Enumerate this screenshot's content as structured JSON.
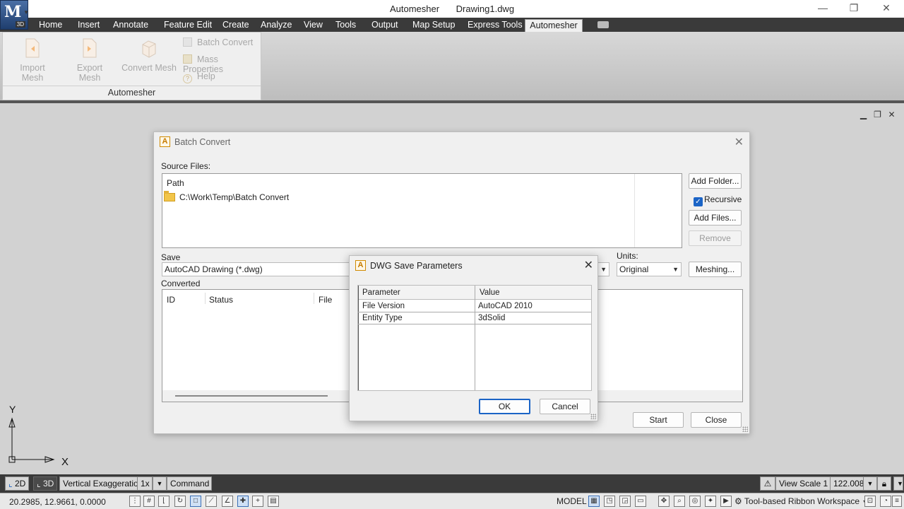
{
  "app": {
    "title": "Automesher",
    "document": "Drawing1.dwg",
    "badge": "3D"
  },
  "menu": {
    "tabs": [
      "Home",
      "Insert",
      "Annotate",
      "Feature Edit",
      "Create",
      "Analyze",
      "View",
      "Tools",
      "Output",
      "Map Setup",
      "Express Tools",
      "Automesher"
    ],
    "active": "Automesher"
  },
  "ribbon": {
    "panel_title": "Automesher",
    "import_mesh": "Import Mesh",
    "export_mesh": "Export Mesh",
    "convert_mesh": "Convert Mesh",
    "batch_convert": "Batch Convert",
    "mass_properties": "Mass Properties",
    "help": "Help"
  },
  "batch_dialog": {
    "title": "Batch Convert",
    "source_files_label": "Source Files:",
    "path_header": "Path",
    "source_path": "C:\\Work\\Temp\\Batch Convert",
    "add_folder": "Add Folder...",
    "recursive": "Recursive",
    "add_files": "Add Files...",
    "remove": "Remove",
    "save_label": "Save",
    "save_format": "AutoCAD Drawing (*.dwg)",
    "units_label": "Units:",
    "units_value": "Original",
    "meshing": "Meshing...",
    "converted_label": "Converted",
    "columns": [
      "ID",
      "Status",
      "File"
    ],
    "start": "Start",
    "close": "Close"
  },
  "dwg_dialog": {
    "title": "DWG Save Parameters",
    "headers": [
      "Parameter",
      "Value"
    ],
    "rows": [
      {
        "param": "File Version",
        "value": "AutoCAD 2010"
      },
      {
        "param": "Entity Type",
        "value": "3dSolid"
      }
    ],
    "ok": "OK",
    "cancel": "Cancel"
  },
  "ucs": {
    "x": "X",
    "y": "Y"
  },
  "layout_bar": {
    "btn_2d": "2D",
    "btn_3d": "3D",
    "vertical_exaggeration": "Vertical Exaggeration:",
    "ve_value": "1x",
    "command": "Command",
    "view_scale": "View Scale",
    "view_scale_ratio": "1 :",
    "view_scale_value": "122.008"
  },
  "status_bar": {
    "coords": "20.2985, 12.9661, 0.0000",
    "model": "MODEL",
    "workspace": "Tool-based Ribbon Workspace"
  },
  "colors": {
    "accent": "#1b64c6",
    "menu_bg": "#3a3a3a",
    "autocad_logo": "#c57a00"
  }
}
